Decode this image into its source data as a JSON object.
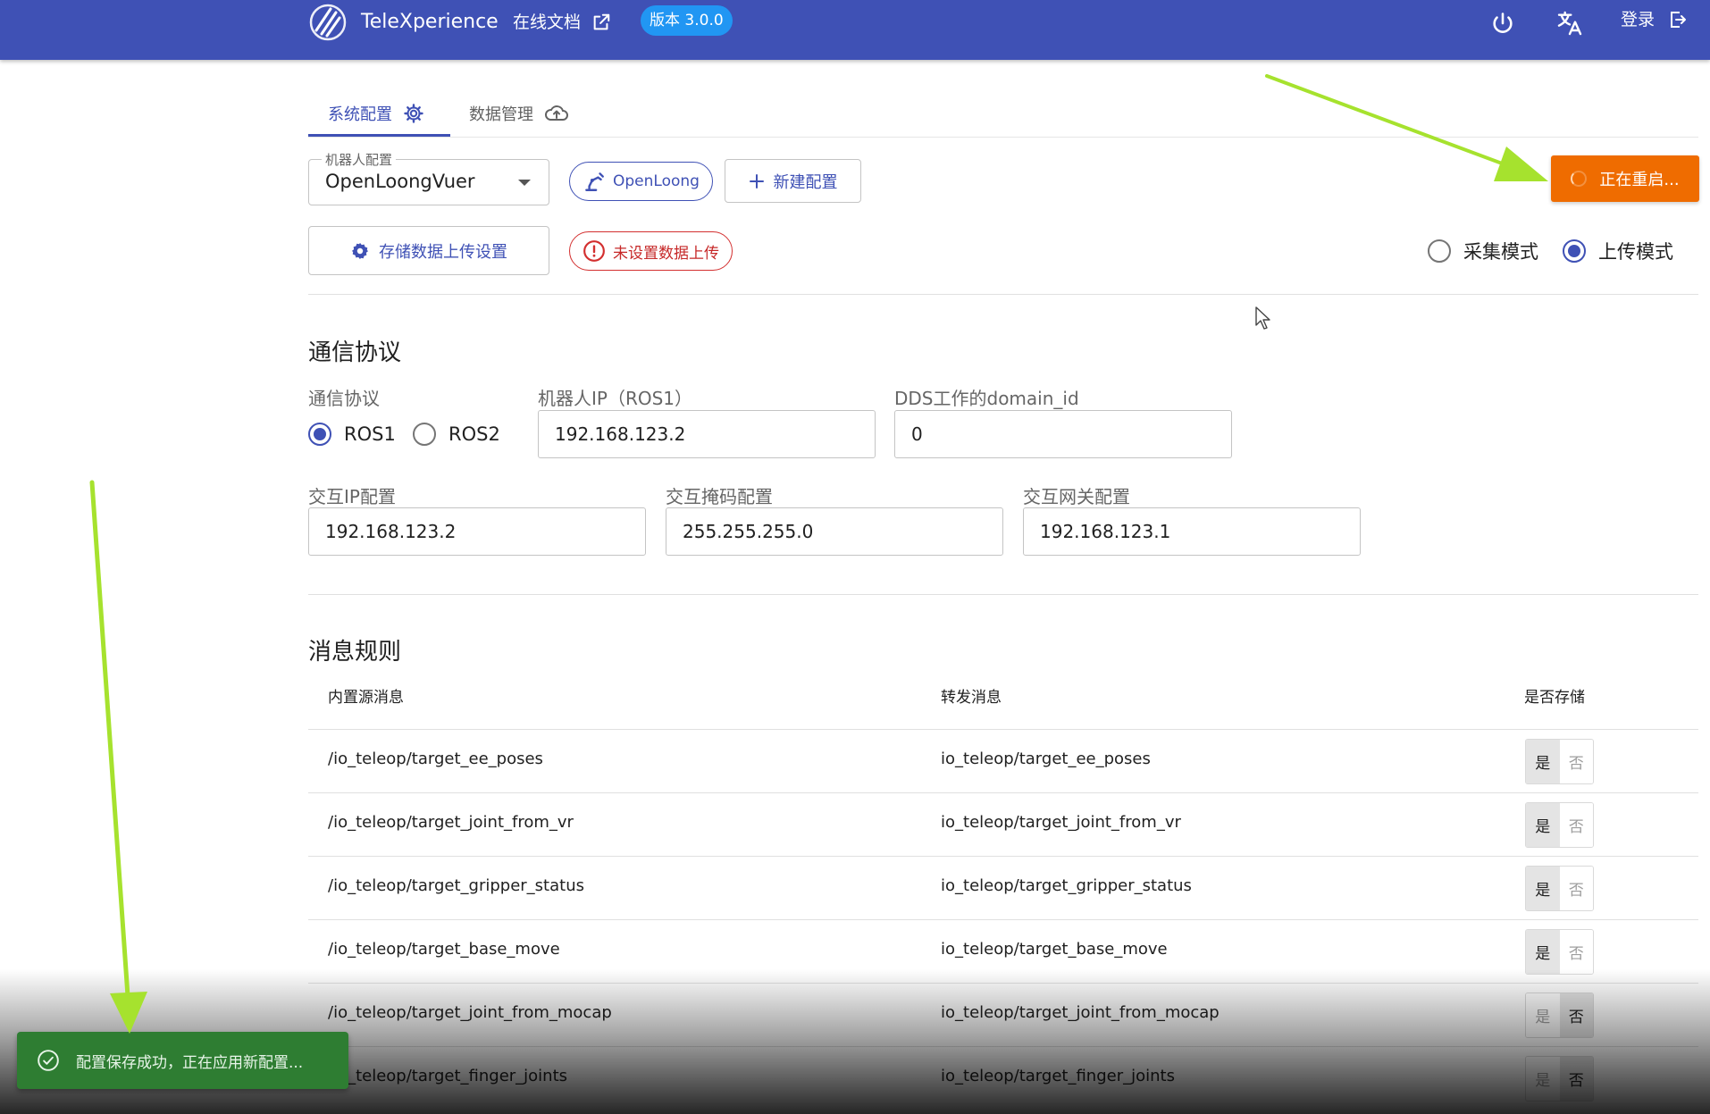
{
  "header": {
    "app_title": "TeleXperience",
    "docs_label": "在线文档",
    "version_label": "版本 3.0.0",
    "power_icon": "power-icon",
    "translate_icon": "translate-icon",
    "login_label": "登录"
  },
  "tabs": [
    {
      "label": "系统配置",
      "icon": "gear-icon",
      "active": true
    },
    {
      "label": "数据管理",
      "icon": "cloud-upload-icon",
      "active": false
    }
  ],
  "robot_config": {
    "label": "机器人配置",
    "value": "OpenLoongVuer",
    "chip_label": "OpenLoong",
    "new_config_label": "新建配置"
  },
  "restart_button": {
    "label": "正在重启...",
    "color": "#ef6c00"
  },
  "upload": {
    "settings_label": "存储数据上传设置",
    "warning_label": "未设置数据上传"
  },
  "mode": {
    "options": [
      "采集模式",
      "上传模式"
    ],
    "selected": "上传模式"
  },
  "comm": {
    "section_title": "通信协议",
    "protocol_label": "通信协议",
    "protocol_options": [
      "ROS1",
      "ROS2"
    ],
    "protocol_selected": "ROS1",
    "robot_ip_label": "机器人IP（ROS1）",
    "robot_ip_value": "192.168.123.2",
    "domain_label": "DDS工作的domain_id",
    "domain_value": "0",
    "ip_label": "交互IP配置",
    "ip_value": "192.168.123.2",
    "mask_label": "交互掩码配置",
    "mask_value": "255.255.255.0",
    "gateway_label": "交互网关配置",
    "gateway_value": "192.168.123.1"
  },
  "rules": {
    "section_title": "消息规则",
    "columns": [
      "内置源消息",
      "转发消息",
      "是否存储"
    ],
    "yes_label": "是",
    "no_label": "否",
    "rows": [
      {
        "source": "/io_teleop/target_ee_poses",
        "forward": "io_teleop/target_ee_poses",
        "store": "是"
      },
      {
        "source": "/io_teleop/target_joint_from_vr",
        "forward": "io_teleop/target_joint_from_vr",
        "store": "是"
      },
      {
        "source": "/io_teleop/target_gripper_status",
        "forward": "io_teleop/target_gripper_status",
        "store": "是"
      },
      {
        "source": "/io_teleop/target_base_move",
        "forward": "io_teleop/target_base_move",
        "store": "是"
      },
      {
        "source": "/io_teleop/target_joint_from_mocap",
        "forward": "io_teleop/target_joint_from_mocap",
        "store": "否"
      },
      {
        "source": "/io_teleop/target_finger_joints",
        "forward": "io_teleop/target_finger_joints",
        "store": "否"
      }
    ]
  },
  "snackbar": {
    "message": "配置保存成功，正在应用新配置...",
    "icon": "check-circle-icon",
    "color": "#2e7d32"
  },
  "colors": {
    "primary": "#3f51b5",
    "accent_blue": "#2196f3",
    "danger": "#d32f2f",
    "annotation_arrow": "#a6e22e"
  }
}
